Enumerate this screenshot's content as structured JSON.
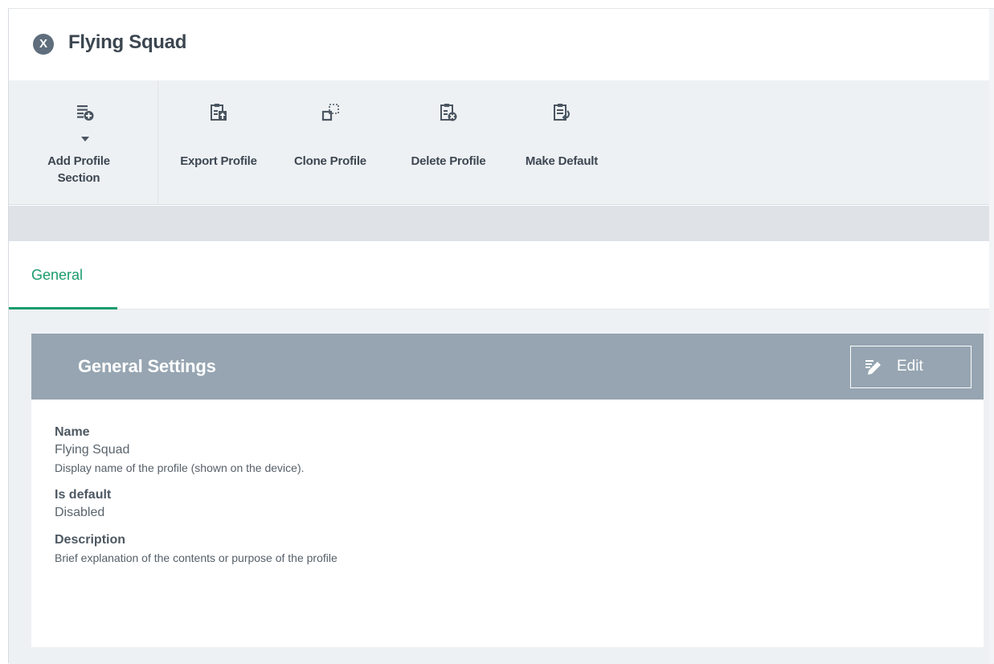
{
  "title_bar": {
    "close_glyph": "X",
    "title": "Flying Squad"
  },
  "toolbar": {
    "buttons": [
      {
        "label": "Add Profile\nSection",
        "icon": "add-list-icon",
        "has_dropdown": true
      },
      {
        "label": "Export Profile",
        "icon": "export-clipboard-icon"
      },
      {
        "label": "Clone Profile",
        "icon": "clone-icon"
      },
      {
        "label": "Delete Profile",
        "icon": "delete-clipboard-icon"
      },
      {
        "label": "Make Default",
        "icon": "default-clipboard-icon"
      }
    ]
  },
  "tabs": [
    {
      "label": "General",
      "active": true
    }
  ],
  "panel": {
    "title": "General Settings",
    "edit_label": "Edit",
    "fields": [
      {
        "name": "Name",
        "value": "Flying Squad",
        "help": "Display name of the profile (shown on the device)."
      },
      {
        "name": "Is default",
        "value": "Disabled",
        "help": ""
      },
      {
        "name": "Description",
        "value": "",
        "help": "Brief explanation of the contents or purpose of the profile"
      }
    ]
  },
  "colors": {
    "accent": "#1a9c6c",
    "panel_header": "#96a5b1",
    "toolbar_bg": "#eef1f4",
    "band": "#dfe3e8",
    "icon": "#4a5560"
  }
}
